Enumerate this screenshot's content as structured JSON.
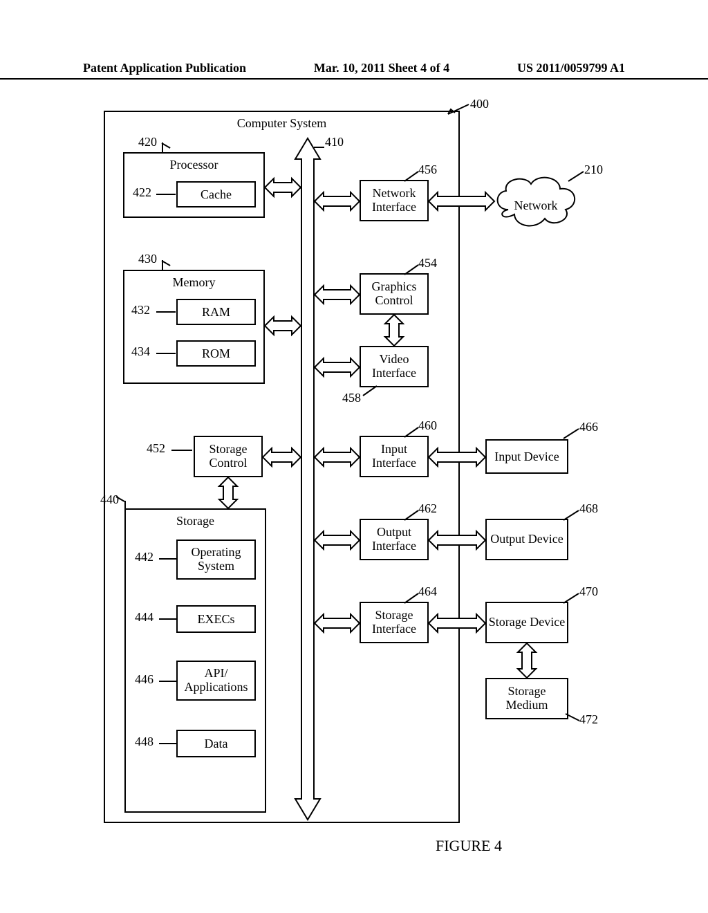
{
  "header": {
    "left": "Patent Application Publication",
    "center": "Mar. 10, 2011  Sheet 4 of 4",
    "right": "US 2011/0059799 A1"
  },
  "figure_caption": "FIGURE 4",
  "system": {
    "title": "Computer System",
    "ref_400": "400",
    "bus_ref": "410"
  },
  "processor": {
    "title": "Processor",
    "ref": "420",
    "cache": {
      "label": "Cache",
      "ref": "422"
    }
  },
  "memory": {
    "title": "Memory",
    "ref": "430",
    "ram": {
      "label": "RAM",
      "ref": "432"
    },
    "rom": {
      "label": "ROM",
      "ref": "434"
    }
  },
  "storage": {
    "title": "Storage",
    "ref": "440",
    "os": {
      "label": "Operating System",
      "ref": "442"
    },
    "exec": {
      "label": "EXECs",
      "ref": "444"
    },
    "api": {
      "label": "API/ Applications",
      "ref": "446"
    },
    "data": {
      "label": "Data",
      "ref": "448"
    }
  },
  "storage_control": {
    "label": "Storage Control",
    "ref": "452"
  },
  "graphics_control": {
    "label": "Graphics Control",
    "ref": "454"
  },
  "network_iface": {
    "label": "Network Interface",
    "ref": "456"
  },
  "video_iface": {
    "label": "Video Interface",
    "ref": "458"
  },
  "input_iface": {
    "label": "Input Interface",
    "ref": "460"
  },
  "output_iface": {
    "label": "Output Interface",
    "ref": "462"
  },
  "storage_iface": {
    "label": "Storage Interface",
    "ref": "464"
  },
  "network": {
    "label": "Network",
    "ref": "210"
  },
  "input_device": {
    "label": "Input Device",
    "ref": "466"
  },
  "output_device": {
    "label": "Output Device",
    "ref": "468"
  },
  "storage_device": {
    "label": "Storage Device",
    "ref": "470"
  },
  "storage_medium": {
    "label": "Storage Medium",
    "ref": "472"
  }
}
